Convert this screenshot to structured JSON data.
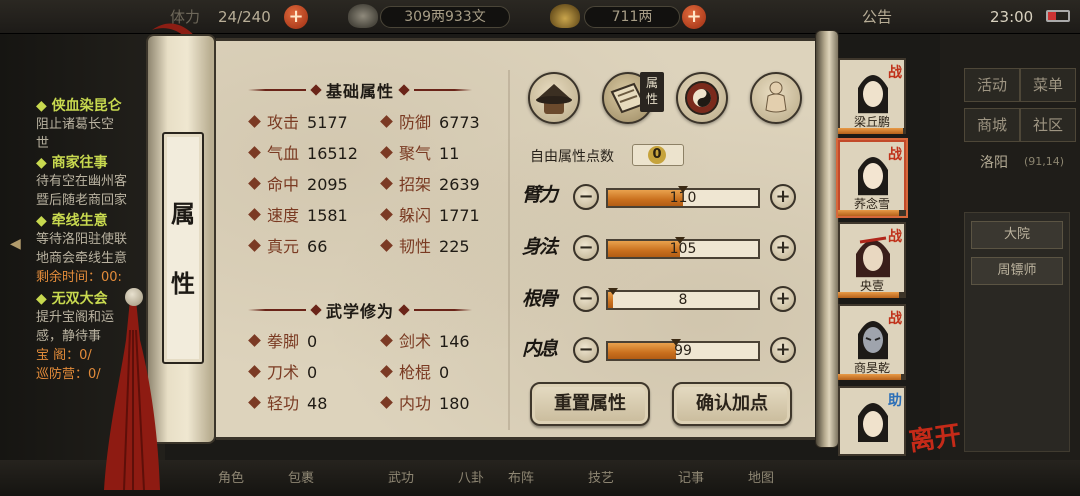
{
  "topbar": {
    "stamina": "24/240",
    "stamina_prefix": "体力",
    "money": "309两933文",
    "gold": "711两",
    "notice_label": "公告",
    "clock": "23:00"
  },
  "quests": [
    {
      "title": "侠血染昆仑",
      "desc": [
        "阻止诸葛长空",
        "世"
      ]
    },
    {
      "title": "商家往事",
      "desc": [
        "待有空在幽州客",
        "暨后随老商回家"
      ]
    },
    {
      "title": "牵线生意",
      "desc": [
        "等待洛阳驻使联",
        "地商会牵线生意"
      ],
      "extra": "剩余时间：00:"
    },
    {
      "title": "无双大会",
      "desc": [
        "提升宝阁和运",
        "感，静待事",
        "宝 阁：0/",
        "巡防营：0/"
      ]
    }
  ],
  "side_menu": {
    "buttons": [
      "活动",
      "菜单",
      "商城",
      "社区"
    ],
    "location": "洛阳",
    "coords": "(91,14)",
    "list_items": [
      "大院",
      "周镖师"
    ]
  },
  "bottom_tabs": [
    "角色",
    "包裹",
    "武功",
    "八卦",
    "布阵",
    "技艺",
    "记事",
    "地图"
  ],
  "scroll_title": [
    "属",
    "性"
  ],
  "base_section": {
    "title": "基础属性",
    "stats": [
      {
        "label": "攻击",
        "value": "5177"
      },
      {
        "label": "防御",
        "value": "6773"
      },
      {
        "label": "气血",
        "value": "16512"
      },
      {
        "label": "聚气",
        "value": "11"
      },
      {
        "label": "命中",
        "value": "2095"
      },
      {
        "label": "招架",
        "value": "2639"
      },
      {
        "label": "速度",
        "value": "1581"
      },
      {
        "label": "躲闪",
        "value": "1771"
      },
      {
        "label": "真元",
        "value": "66"
      },
      {
        "label": "韧性",
        "value": "225"
      }
    ]
  },
  "martial_section": {
    "title": "武学修为",
    "stats": [
      {
        "label": "拳脚",
        "value": "0"
      },
      {
        "label": "剑术",
        "value": "146"
      },
      {
        "label": "刀术",
        "value": "0"
      },
      {
        "label": "枪棍",
        "value": "0"
      },
      {
        "label": "轻功",
        "value": "48"
      },
      {
        "label": "内功",
        "value": "180"
      }
    ]
  },
  "tabs": {
    "icons": [
      "hat-icon",
      "scroll-bag-icon",
      "yin-yang-icon",
      "meridian-figure-icon"
    ],
    "badge": [
      "属",
      "性"
    ]
  },
  "free_points": {
    "label": "自由属性点数",
    "value": "0"
  },
  "attributes": [
    {
      "name": "臂力",
      "value": 110,
      "max": 220
    },
    {
      "name": "身法",
      "value": 105,
      "max": 220
    },
    {
      "name": "根骨",
      "value": 8,
      "max": 220
    },
    {
      "name": "内息",
      "value": 99,
      "max": 220
    }
  ],
  "actions": {
    "reset": "重置属性",
    "confirm": "确认加点"
  },
  "party": [
    {
      "name": "梁丘鹏",
      "tag": "战",
      "hp": 0.95,
      "selected": false
    },
    {
      "name": "荞念雪",
      "tag": "战",
      "hp": 0.9,
      "selected": true
    },
    {
      "name": "央壹",
      "tag": "战",
      "hp": 0.9,
      "selected": false
    },
    {
      "name": "商昊乾",
      "tag": "战",
      "hp": 0.92,
      "selected": false
    },
    {
      "name": "",
      "tag": "助",
      "hp": 1.0,
      "selected": false
    }
  ],
  "leave_label": "离开",
  "colors": {
    "accent_red": "#c0311a",
    "bar_fill": "#c9701e",
    "paper": "#ddd3bc"
  }
}
